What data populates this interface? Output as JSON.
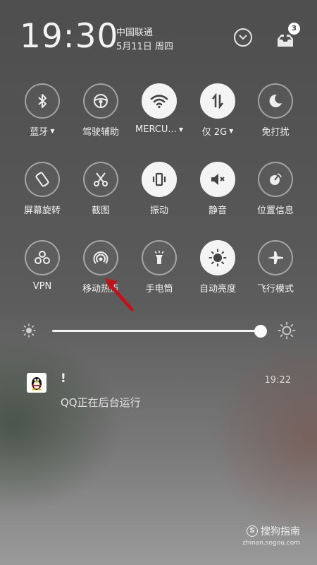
{
  "status": {
    "time": "19:30",
    "carrier": "中国联通",
    "date": "5月11日 周四",
    "inbox_badge": "3"
  },
  "tiles": [
    {
      "label": "蓝牙",
      "icon": "bluetooth-icon",
      "on": false,
      "caret": true
    },
    {
      "label": "驾驶辅助",
      "icon": "steering-wheel-icon",
      "on": false,
      "caret": false
    },
    {
      "label": "MERCU...",
      "icon": "wifi-icon",
      "on": true,
      "caret": true
    },
    {
      "label": "仅 2G",
      "icon": "data-transfer-icon",
      "on": true,
      "caret": true
    },
    {
      "label": "免打扰",
      "icon": "moon-icon",
      "on": false,
      "caret": false
    },
    {
      "label": "屏幕旋转",
      "icon": "rotate-screen-icon",
      "on": false,
      "caret": false
    },
    {
      "label": "截图",
      "icon": "scissors-icon",
      "on": false,
      "caret": false
    },
    {
      "label": "振动",
      "icon": "vibrate-icon",
      "on": true,
      "caret": false
    },
    {
      "label": "静音",
      "icon": "mute-icon",
      "on": true,
      "caret": false
    },
    {
      "label": "位置信息",
      "icon": "location-icon",
      "on": false,
      "caret": false
    },
    {
      "label": "VPN",
      "icon": "vpn-icon",
      "on": false,
      "caret": false
    },
    {
      "label": "移动热点",
      "icon": "hotspot-icon",
      "on": false,
      "caret": false
    },
    {
      "label": "手电筒",
      "icon": "flashlight-icon",
      "on": false,
      "caret": false
    },
    {
      "label": "自动亮度",
      "icon": "auto-brightness-icon",
      "on": true,
      "caret": false
    },
    {
      "label": "飞行模式",
      "icon": "airplane-icon",
      "on": false,
      "caret": false
    }
  ],
  "brightness": {
    "level": 1.0
  },
  "notification": {
    "app_icon": "qq-penguin-icon",
    "title": "!",
    "time": "19:22",
    "body": "QQ正在后台运行"
  },
  "watermark": {
    "brand": "搜狗指南",
    "url": "zhinan.sogou.com"
  }
}
